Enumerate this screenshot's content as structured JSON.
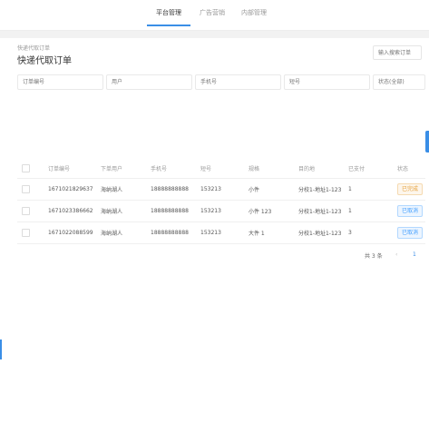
{
  "topnav": {
    "tabs": [
      {
        "label": "平台管理",
        "active": true
      },
      {
        "label": "广告营销",
        "active": false
      },
      {
        "label": "内部管理",
        "active": false
      }
    ],
    "accent_color": "#3a8ee6"
  },
  "header": {
    "breadcrumb": "快递代取订单",
    "title": "快递代取订单",
    "search_placeholder": "输入搜索订单"
  },
  "filters": [
    {
      "placeholder": "订单编号"
    },
    {
      "placeholder": "用户"
    },
    {
      "placeholder": "手机号"
    },
    {
      "placeholder": "短号"
    },
    {
      "placeholder": "状态(全部)"
    }
  ],
  "table": {
    "columns": [
      "订单编号",
      "下单用户",
      "手机号",
      "短号",
      "规格",
      "目的地",
      "已支付",
      "状态"
    ],
    "rows": [
      {
        "order_no": "1671021829637",
        "user": "海纳湖人",
        "phone": "18888888888",
        "short_no": "153213",
        "spec": "小件",
        "destination": "分校1-地址1-123",
        "paid": "1",
        "status": "已完成",
        "status_color": "#e6a23c",
        "status_bg": "#fdf6ec"
      },
      {
        "order_no": "1671023386662",
        "user": "海纳湖人",
        "phone": "18888888888",
        "short_no": "153213",
        "spec": "小件 123",
        "destination": "分校1-地址1-123",
        "paid": "1",
        "status": "已取消",
        "status_color": "#409eff",
        "status_bg": "#ecf5ff"
      },
      {
        "order_no": "1671022088599",
        "user": "海纳湖人",
        "phone": "18888888888",
        "short_no": "153213",
        "spec": "大件 1",
        "destination": "分校1-地址1-123",
        "paid": "3",
        "status": "已取消",
        "status_color": "#409eff",
        "status_bg": "#ecf5ff"
      }
    ]
  },
  "pagination": {
    "total_text": "共 3 条",
    "prev_icon": "‹",
    "current_page": "1"
  }
}
